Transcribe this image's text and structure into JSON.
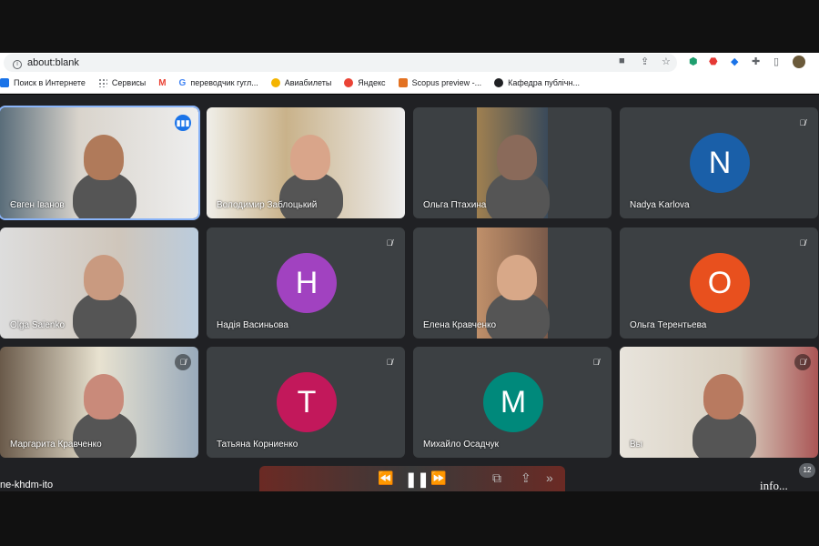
{
  "browser": {
    "url_prefix": "about:",
    "url_host": "blank"
  },
  "bookmarks": [
    {
      "label": "Поиск в Интернете",
      "color": "#1a73e8"
    },
    {
      "label": "Сервисы",
      "color": "#5f6368"
    },
    {
      "label": "",
      "color": "#ea4335",
      "icon": "gmail-icon"
    },
    {
      "label": "переводчик гугл...",
      "color": "#4285f4"
    },
    {
      "label": "Авиабилеты",
      "color": "#f4b400"
    },
    {
      "label": "Яндекс",
      "color": "#ea4335"
    },
    {
      "label": "Scopus preview -...",
      "color": "#e37222"
    },
    {
      "label": "Кафедра публічн...",
      "color": "#202124"
    }
  ],
  "participants": [
    {
      "name": "Євген Іванов",
      "type": "video",
      "speaking": true
    },
    {
      "name": "Володимир Заблоцький",
      "type": "video"
    },
    {
      "name": "Ольга Птахина",
      "type": "video"
    },
    {
      "name": "Nadya Karlova",
      "type": "avatar",
      "initial": "N",
      "color": "#1a5fa8",
      "muted": true
    },
    {
      "name": "Olga Saienko",
      "type": "video"
    },
    {
      "name": "Надія Васиньова",
      "type": "avatar",
      "initial": "H",
      "color": "#a142c0",
      "muted": true
    },
    {
      "name": "Елена Кравченко",
      "type": "video"
    },
    {
      "name": "Ольга Терентьева",
      "type": "avatar",
      "initial": "O",
      "color": "#e8501e",
      "muted": true
    },
    {
      "name": "Маргарита Кравченко",
      "type": "video",
      "muted": true
    },
    {
      "name": "Татьяна Корниенко",
      "type": "avatar",
      "initial": "T",
      "color": "#c2185b",
      "muted": true
    },
    {
      "name": "Михайло Осадчук",
      "type": "avatar",
      "initial": "M",
      "color": "#00897b",
      "muted": true
    },
    {
      "name": "Вы",
      "type": "video",
      "muted": true
    }
  ],
  "footer": {
    "meeting_code": "ne-khdm-ito",
    "participant_count": "12",
    "watermark": "info..."
  },
  "player": {
    "rewind": "⏪",
    "pause": "❚❚",
    "forward": "⏩",
    "pip": "⧉",
    "share": "⇪",
    "more": "»"
  }
}
